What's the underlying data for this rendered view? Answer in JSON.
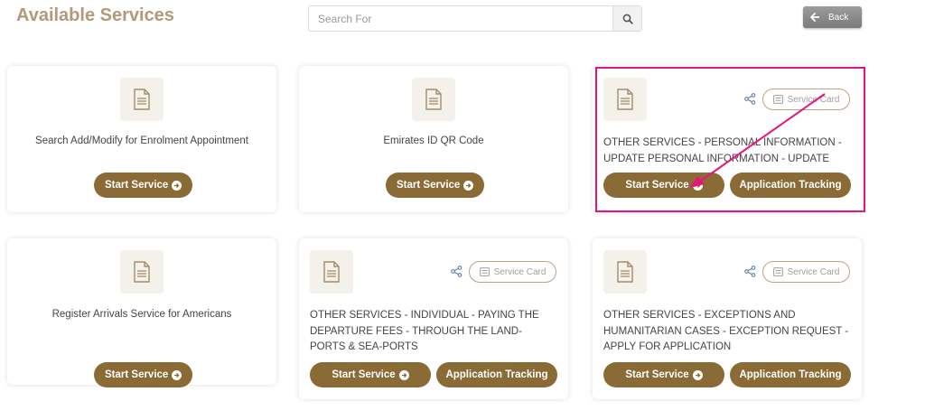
{
  "header": {
    "title": "Available Services",
    "search_placeholder": "Search For",
    "back_label": "Back"
  },
  "cards": [
    {
      "description": "Search Add/Modify for Enrolment Appointment",
      "start_label": "Start Service"
    },
    {
      "description": "Emirates ID QR Code",
      "start_label": "Start Service"
    },
    {
      "description": "OTHER SERVICES - PERSONAL INFORMATION - UPDATE PERSONAL INFORMATION - UPDATE",
      "start_label": "Start Service",
      "track_label": "Application Tracking",
      "service_card_label": "Service Card"
    },
    {
      "description": "Register Arrivals Service for Americans",
      "start_label": "Start Service"
    },
    {
      "description": "OTHER SERVICES - INDIVIDUAL - PAYING THE DEPARTURE FEES - THROUGH THE LAND-PORTS & SEA-PORTS",
      "start_label": "Start Service",
      "track_label": "Application Tracking",
      "service_card_label": "Service Card"
    },
    {
      "description": "OTHER SERVICES - EXCEPTIONS AND HUMANITARIAN CASES - EXCEPTION REQUEST - APPLY FOR APPLICATION",
      "start_label": "Start Service",
      "track_label": "Application Tracking",
      "service_card_label": "Service Card"
    }
  ],
  "colors": {
    "title": "#b2997a",
    "button": "#8a6a35",
    "highlight": "#e6157e",
    "icon_background": "#f4f0ea"
  },
  "icons": {
    "document": "document-icon",
    "search": "search-icon",
    "share": "share-icon",
    "arrow_circle": "arrow-circle-right-icon",
    "back": "arrow-left-icon"
  }
}
